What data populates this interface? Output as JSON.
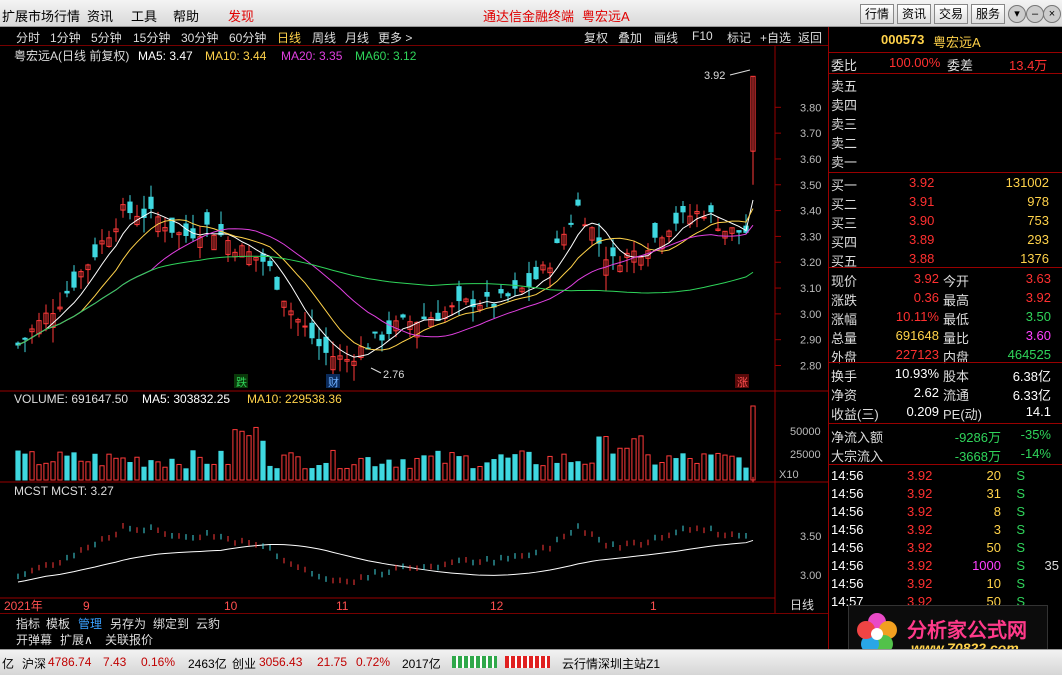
{
  "menu": {
    "items": [
      "扩展市场行情",
      "资讯",
      "工具",
      "帮助"
    ],
    "logo_text": "发现",
    "center_items": [
      "通达信金融终端",
      "粤宏远A"
    ],
    "buttons": [
      "行情",
      "资讯",
      "交易",
      "服务"
    ]
  },
  "toolbar": {
    "periods": [
      "分时",
      "1分钟",
      "5分钟",
      "15分钟",
      "30分钟",
      "60分钟",
      "日线",
      "周线",
      "月线",
      "更多 >"
    ],
    "selected": "日线",
    "actions": [
      "复权",
      "叠加",
      "画线",
      "F10",
      "标记",
      "+自选",
      "返回"
    ]
  },
  "chart_data": {
    "type": "candlestick",
    "title": "粤宏远A(日线 前复权)",
    "ma_legend": [
      {
        "name": "MA5: 3.47",
        "color": "#ffffff"
      },
      {
        "name": "MA10: 3.44",
        "color": "#ffd24a"
      },
      {
        "name": "MA20: 3.35",
        "color": "#e040e0"
      },
      {
        "name": "MA60: 3.12",
        "color": "#2fd45a"
      }
    ],
    "y_ticks": [
      "3.80",
      "3.70",
      "3.60",
      "3.50",
      "3.40",
      "3.30",
      "3.20",
      "3.10",
      "3.00",
      "2.90",
      "2.80"
    ],
    "ylim": [
      2.74,
      3.96
    ],
    "annotations": {
      "high": "3.92",
      "low": "2.76"
    },
    "markers": [
      "跌",
      "财",
      "涨"
    ],
    "volume": {
      "legend": "VOLUME: 691647.50",
      "ma5": "MA5: 303832.25",
      "ma10": "MA10: 229538.36",
      "ticks": [
        "50000",
        "25000"
      ],
      "unit": "X10"
    },
    "mcst": {
      "legend": "MCST  MCST: 3.27",
      "ticks": [
        "3.50",
        "3.00"
      ]
    },
    "x_labels": [
      "2021年",
      "9",
      "10",
      "11",
      "12",
      "1"
    ],
    "period_label": "日线"
  },
  "quote": {
    "code": "000573",
    "name": "粤宏远A",
    "weibi_label": "委比",
    "weibi": "100.00%",
    "weicha_label": "委差",
    "weicha": "13.4万",
    "asks": [
      {
        "label": "卖五",
        "price": "",
        "vol": ""
      },
      {
        "label": "卖四",
        "price": "",
        "vol": ""
      },
      {
        "label": "卖三",
        "price": "",
        "vol": ""
      },
      {
        "label": "卖二",
        "price": "",
        "vol": ""
      },
      {
        "label": "卖一",
        "price": "",
        "vol": ""
      }
    ],
    "bids": [
      {
        "label": "买一",
        "price": "3.92",
        "vol": "131002"
      },
      {
        "label": "买二",
        "price": "3.91",
        "vol": "978"
      },
      {
        "label": "买三",
        "price": "3.90",
        "vol": "753"
      },
      {
        "label": "买四",
        "price": "3.89",
        "vol": "293"
      },
      {
        "label": "买五",
        "price": "3.88",
        "vol": "1376"
      }
    ],
    "stats": [
      {
        "l1": "现价",
        "v1": "3.92",
        "c1": "red",
        "l2": "今开",
        "v2": "3.63",
        "c2": "red"
      },
      {
        "l1": "涨跌",
        "v1": "0.36",
        "c1": "red",
        "l2": "最高",
        "v2": "3.92",
        "c2": "red"
      },
      {
        "l1": "涨幅",
        "v1": "10.11%",
        "c1": "red",
        "l2": "最低",
        "v2": "3.50",
        "c2": "grn"
      },
      {
        "l1": "总量",
        "v1": "691648",
        "c1": "yel",
        "l2": "量比",
        "v2": "3.60",
        "c2": "mag"
      },
      {
        "l1": "外盘",
        "v1": "227123",
        "c1": "red",
        "l2": "内盘",
        "v2": "464525",
        "c2": "grn"
      }
    ],
    "stats2": [
      {
        "l1": "换手",
        "v1": "10.93%",
        "l2": "股本",
        "v2": "6.38亿"
      },
      {
        "l1": "净资",
        "v1": "2.62",
        "l2": "流通",
        "v2": "6.33亿"
      },
      {
        "l1": "收益(三)",
        "v1": "0.209",
        "l2": "PE(动)",
        "v2": "14.1"
      }
    ],
    "flows": [
      {
        "label": "净流入额",
        "v1": "-9286万",
        "v2": "-35%"
      },
      {
        "label": "大宗流入",
        "v1": "-3668万",
        "v2": "-14%"
      }
    ],
    "ticks": [
      {
        "t": "14:56",
        "p": "3.92",
        "v": "20",
        "s": "S",
        "x": ""
      },
      {
        "t": "14:56",
        "p": "3.92",
        "v": "31",
        "s": "S",
        "x": ""
      },
      {
        "t": "14:56",
        "p": "3.92",
        "v": "8",
        "s": "S",
        "x": ""
      },
      {
        "t": "14:56",
        "p": "3.92",
        "v": "3",
        "s": "S",
        "x": ""
      },
      {
        "t": "14:56",
        "p": "3.92",
        "v": "50",
        "s": "S",
        "x": ""
      },
      {
        "t": "14:56",
        "p": "3.92",
        "v": "1000",
        "s": "S",
        "x": "35"
      },
      {
        "t": "14:56",
        "p": "3.92",
        "v": "10",
        "s": "S",
        "x": ""
      },
      {
        "t": "14:57",
        "p": "3.92",
        "v": "50",
        "s": "S",
        "x": ""
      }
    ]
  },
  "bottom_tabs": [
    "指标",
    "模板",
    "管理",
    "另存为",
    "绑定到",
    "云豹"
  ],
  "bottom_selected": "管理",
  "row2": [
    "开弹幕",
    "扩展∧",
    "关联报价"
  ],
  "status": {
    "prefix": "亿",
    "sh_label": "沪深",
    "sh_value": "4786.74",
    "sh_change": "7.43",
    "sh_pct": "0.16%",
    "sh_amount": "2463亿",
    "cy_label": "创业",
    "cy_value": "3056.43",
    "cy_change": "21.75",
    "cy_pct": "0.72%",
    "cy_amount": "2017亿",
    "server": "云行情深圳主站Z1"
  },
  "brand": {
    "name": "分析家公式网",
    "url": "www.70822.com"
  }
}
